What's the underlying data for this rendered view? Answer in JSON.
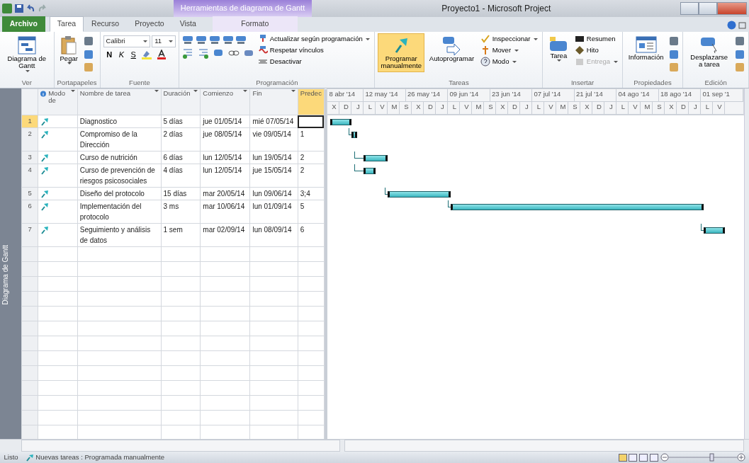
{
  "window": {
    "title": "Proyecto1 - Microsoft Project",
    "context_tab": "Herramientas de diagrama de Gantt"
  },
  "tabs": [
    {
      "label": "Archivo",
      "kind": "file",
      "selected": false
    },
    {
      "label": "Tarea",
      "kind": "tab",
      "selected": true
    },
    {
      "label": "Recurso",
      "kind": "tab",
      "selected": false
    },
    {
      "label": "Proyecto",
      "kind": "tab",
      "selected": false
    },
    {
      "label": "Vista",
      "kind": "tab",
      "selected": false
    },
    {
      "label": "Formato",
      "kind": "context",
      "selected": false
    }
  ],
  "ribbon": [
    {
      "label": "Ver",
      "buttons": [
        {
          "kind": "large",
          "label": "Diagrama de Gantt",
          "dropdown": true
        }
      ]
    },
    {
      "label": "Portapapeles",
      "buttons": [
        {
          "kind": "large",
          "label": "Pegar",
          "dropdown": true
        },
        {
          "kind": "stack"
        }
      ]
    },
    {
      "label": "Fuente",
      "buttons": [
        {
          "kind": "font",
          "font": "Calibri",
          "size": "11",
          "styles": [
            "N",
            "K",
            "S"
          ]
        }
      ]
    },
    {
      "label": "Programación",
      "buttons": [
        {
          "kind": "sched"
        },
        {
          "kind": "small",
          "label": "Actualizar según programación",
          "dropdown": true,
          "disabled": false
        },
        {
          "kind": "small",
          "label": "Respetar vínculos",
          "dropdown": false,
          "disabled": false
        },
        {
          "kind": "small",
          "label": "Desactivar",
          "dropdown": false,
          "disabled": false
        }
      ]
    },
    {
      "label": "Tareas",
      "buttons": [
        {
          "kind": "large",
          "label": "Programar manualmente",
          "dropdown": false,
          "selected": true
        },
        {
          "kind": "large",
          "label": "Autoprogramar",
          "dropdown": false,
          "selected": false
        },
        {
          "kind": "small",
          "label": "Inspeccionar",
          "dropdown": true,
          "disabled": false
        },
        {
          "kind": "small",
          "label": "Mover",
          "dropdown": true,
          "disabled": false
        },
        {
          "kind": "small",
          "label": "Modo",
          "dropdown": true,
          "disabled": false
        }
      ]
    },
    {
      "label": "Insertar",
      "buttons": [
        {
          "kind": "large",
          "label": "Tarea",
          "dropdown": true
        },
        {
          "kind": "small",
          "label": "Resumen",
          "dropdown": false,
          "disabled": false
        },
        {
          "kind": "small",
          "label": "Hito",
          "dropdown": false,
          "disabled": false
        },
        {
          "kind": "small",
          "label": "Entrega",
          "dropdown": true,
          "disabled": true
        }
      ]
    },
    {
      "label": "Propiedades",
      "buttons": [
        {
          "kind": "large",
          "label": "Información",
          "dropdown": false
        },
        {
          "kind": "stack"
        }
      ]
    },
    {
      "label": "Edición",
      "buttons": [
        {
          "kind": "large",
          "label": "Desplazarse a tarea",
          "dropdown": false
        },
        {
          "kind": "stack"
        }
      ]
    }
  ],
  "table": {
    "columns": [
      "Modo de",
      "Nombre de tarea",
      "Duración",
      "Comienzo",
      "Fin",
      "Predec"
    ],
    "rows": [
      {
        "id": "1",
        "name": "Diagnostico",
        "duration": "5 días",
        "start": "jue 01/05/14",
        "finish": "mié 07/05/14",
        "pred": "",
        "selected": true
      },
      {
        "id": "2",
        "name": "Compromiso de la Dirección",
        "duration": "2 días",
        "start": "jue 08/05/14",
        "finish": "vie 09/05/14",
        "pred": "1",
        "selected": false
      },
      {
        "id": "3",
        "name": "Curso de nutrición",
        "duration": "6 días",
        "start": "lun 12/05/14",
        "finish": "lun 19/05/14",
        "pred": "2",
        "selected": false
      },
      {
        "id": "4",
        "name": "Curso de prevención de riesgos psicosociales",
        "duration": "4 días",
        "start": "lun 12/05/14",
        "finish": "jue 15/05/14",
        "pred": "2",
        "selected": false
      },
      {
        "id": "5",
        "name": "Diseño del protocolo",
        "duration": "15 días",
        "start": "mar 20/05/14",
        "finish": "lun 09/06/14",
        "pred": "3;4",
        "selected": false
      },
      {
        "id": "6",
        "name": "Implementación del protocolo",
        "duration": "3 ms",
        "start": "mar 10/06/14",
        "finish": "lun 01/09/14",
        "pred": "5",
        "selected": false
      },
      {
        "id": "7",
        "name": "Seguimiento y análisis de datos",
        "duration": "1 sem",
        "start": "mar 02/09/14",
        "finish": "lun 08/09/14",
        "pred": "6",
        "selected": false
      }
    ]
  },
  "timescale": {
    "major": [
      "8 abr '14",
      "12 may '14",
      "26 may '14",
      "09 jun '14",
      "23 jun '14",
      "07 jul '14",
      "21 jul '14",
      "04 ago '14",
      "18 ago '14",
      "01 sep '1"
    ],
    "minor": [
      "X",
      "D",
      "J",
      "L",
      "V",
      "M",
      "S",
      "X",
      "D",
      "J",
      "L",
      "V",
      "M",
      "S",
      "X",
      "D",
      "J",
      "L",
      "V",
      "M",
      "S",
      "X",
      "D",
      "J",
      "L",
      "V",
      "M",
      "S",
      "X",
      "D",
      "J",
      "L",
      "V"
    ]
  },
  "side_label": "Diagrama de Gantt",
  "status_bar": {
    "ready": "Listo",
    "mode": "Nuevas tareas : Programada manualmente"
  }
}
